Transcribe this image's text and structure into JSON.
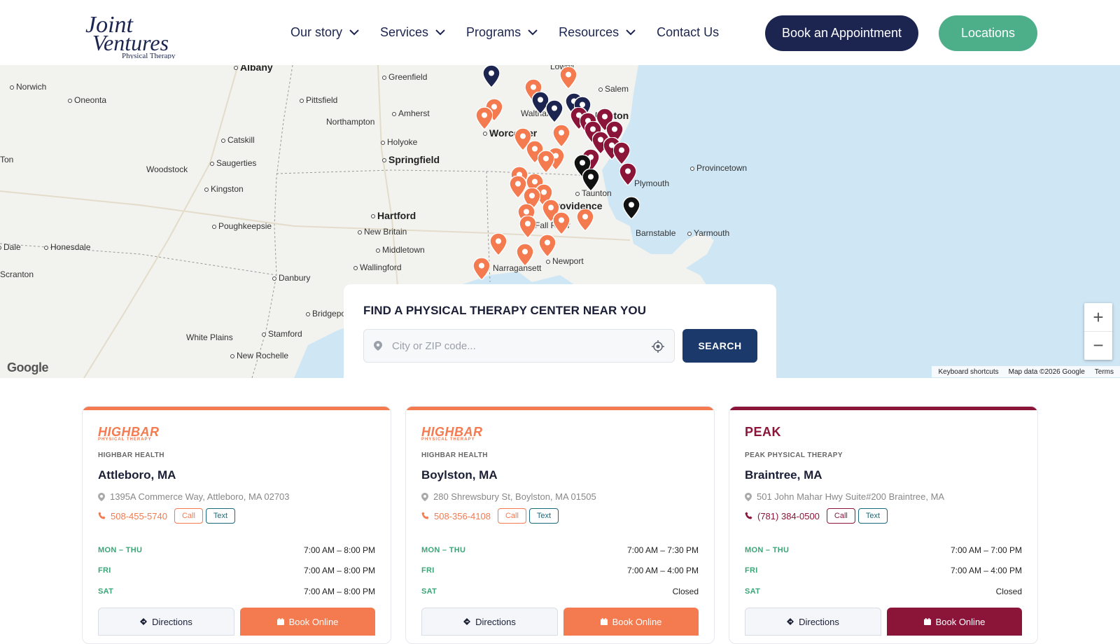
{
  "brand": {
    "logo_line1": "Joint",
    "logo_line2": "Ventures",
    "logo_tagline": "Physical Therapy",
    "colors": {
      "navy": "#1b2550",
      "green": "#4caf89",
      "orange": "#f47a50",
      "maroon": "#8b1538"
    }
  },
  "nav": {
    "items": [
      {
        "label": "Our story",
        "has_dropdown": true
      },
      {
        "label": "Services",
        "has_dropdown": true
      },
      {
        "label": "Programs",
        "has_dropdown": true
      },
      {
        "label": "Resources",
        "has_dropdown": true
      },
      {
        "label": "Contact Us",
        "has_dropdown": false
      }
    ],
    "book_label": "Book an Appointment",
    "locations_label": "Locations"
  },
  "map": {
    "places": [
      "Albany",
      "Norwich",
      "Oneonta",
      "Greenfield",
      "Salem",
      "Pittsfield",
      "Amherst",
      "Northampton",
      "Waltham",
      "Worcester",
      "Catskill",
      "Holyoke",
      "Springfield",
      "Woodstock",
      "Saugerties",
      "Provincetown",
      "Kingston",
      "Plymouth",
      "Taunton",
      "Providence",
      "Hartford",
      "Poughkeepsie",
      "New Britain",
      "Barnstable",
      "Yarmouth",
      "Fall River",
      "Honesdale",
      "Middletown",
      "Wallingford",
      "Newport",
      "Narragansett",
      "Scranton",
      "Danbury",
      "Bridgeport",
      "Stamford",
      "White Plains",
      "New Rochelle",
      "Boston",
      "Lowell",
      "Dale",
      "Ton"
    ],
    "google_label": "Google",
    "footer": [
      "Keyboard shortcuts",
      "Map data ©2026 Google",
      "Terms"
    ],
    "zoom_in": "+",
    "zoom_out": "−"
  },
  "search": {
    "title": "FIND A PHYSICAL THERAPY CENTER NEAR YOU",
    "placeholder": "City or ZIP code...",
    "button": "SEARCH"
  },
  "cards": [
    {
      "logo_text": "HIGHBAR",
      "logo_sub": "PHYSICAL THERAPY",
      "brand": "HIGHBAR HEALTH",
      "city": "Attleboro, MA",
      "address": "1395A Commerce Way, Attleboro, MA 02703",
      "phone": "508-455-5740",
      "call": "Call",
      "text": "Text",
      "accent": "#f47a50",
      "hours": [
        {
          "day": "MON – THU",
          "time": "7:00 AM – 8:00 PM"
        },
        {
          "day": "FRI",
          "time": "7:00 AM – 8:00 PM"
        },
        {
          "day": "SAT",
          "time": "7:00 AM – 8:00 PM"
        }
      ],
      "directions": "Directions",
      "book": "Book Online"
    },
    {
      "logo_text": "HIGHBAR",
      "logo_sub": "PHYSICAL THERAPY",
      "brand": "HIGHBAR HEALTH",
      "city": "Boylston, MA",
      "address": "280 Shrewsbury St, Boylston, MA 01505",
      "phone": "508-356-4108",
      "call": "Call",
      "text": "Text",
      "accent": "#f47a50",
      "hours": [
        {
          "day": "MON – THU",
          "time": "7:00 AM – 7:30 PM"
        },
        {
          "day": "FRI",
          "time": "7:00 AM – 4:00 PM"
        },
        {
          "day": "SAT",
          "time": "Closed"
        }
      ],
      "directions": "Directions",
      "book": "Book Online"
    },
    {
      "logo_text": "PEAK",
      "logo_sub": "",
      "brand": "PEAK PHYSICAL THERAPY",
      "city": "Braintree, MA",
      "address": "501 John Mahar Hwy Suite#200 Braintree, MA",
      "phone": "(781) 384-0500",
      "call": "Call",
      "text": "Text",
      "accent": "#8b1538",
      "hours": [
        {
          "day": "MON – THU",
          "time": "7:00 AM – 7:00 PM"
        },
        {
          "day": "FRI",
          "time": "7:00 AM – 4:00 PM"
        },
        {
          "day": "SAT",
          "time": "Closed"
        }
      ],
      "directions": "Directions",
      "book": "Book Online"
    }
  ]
}
